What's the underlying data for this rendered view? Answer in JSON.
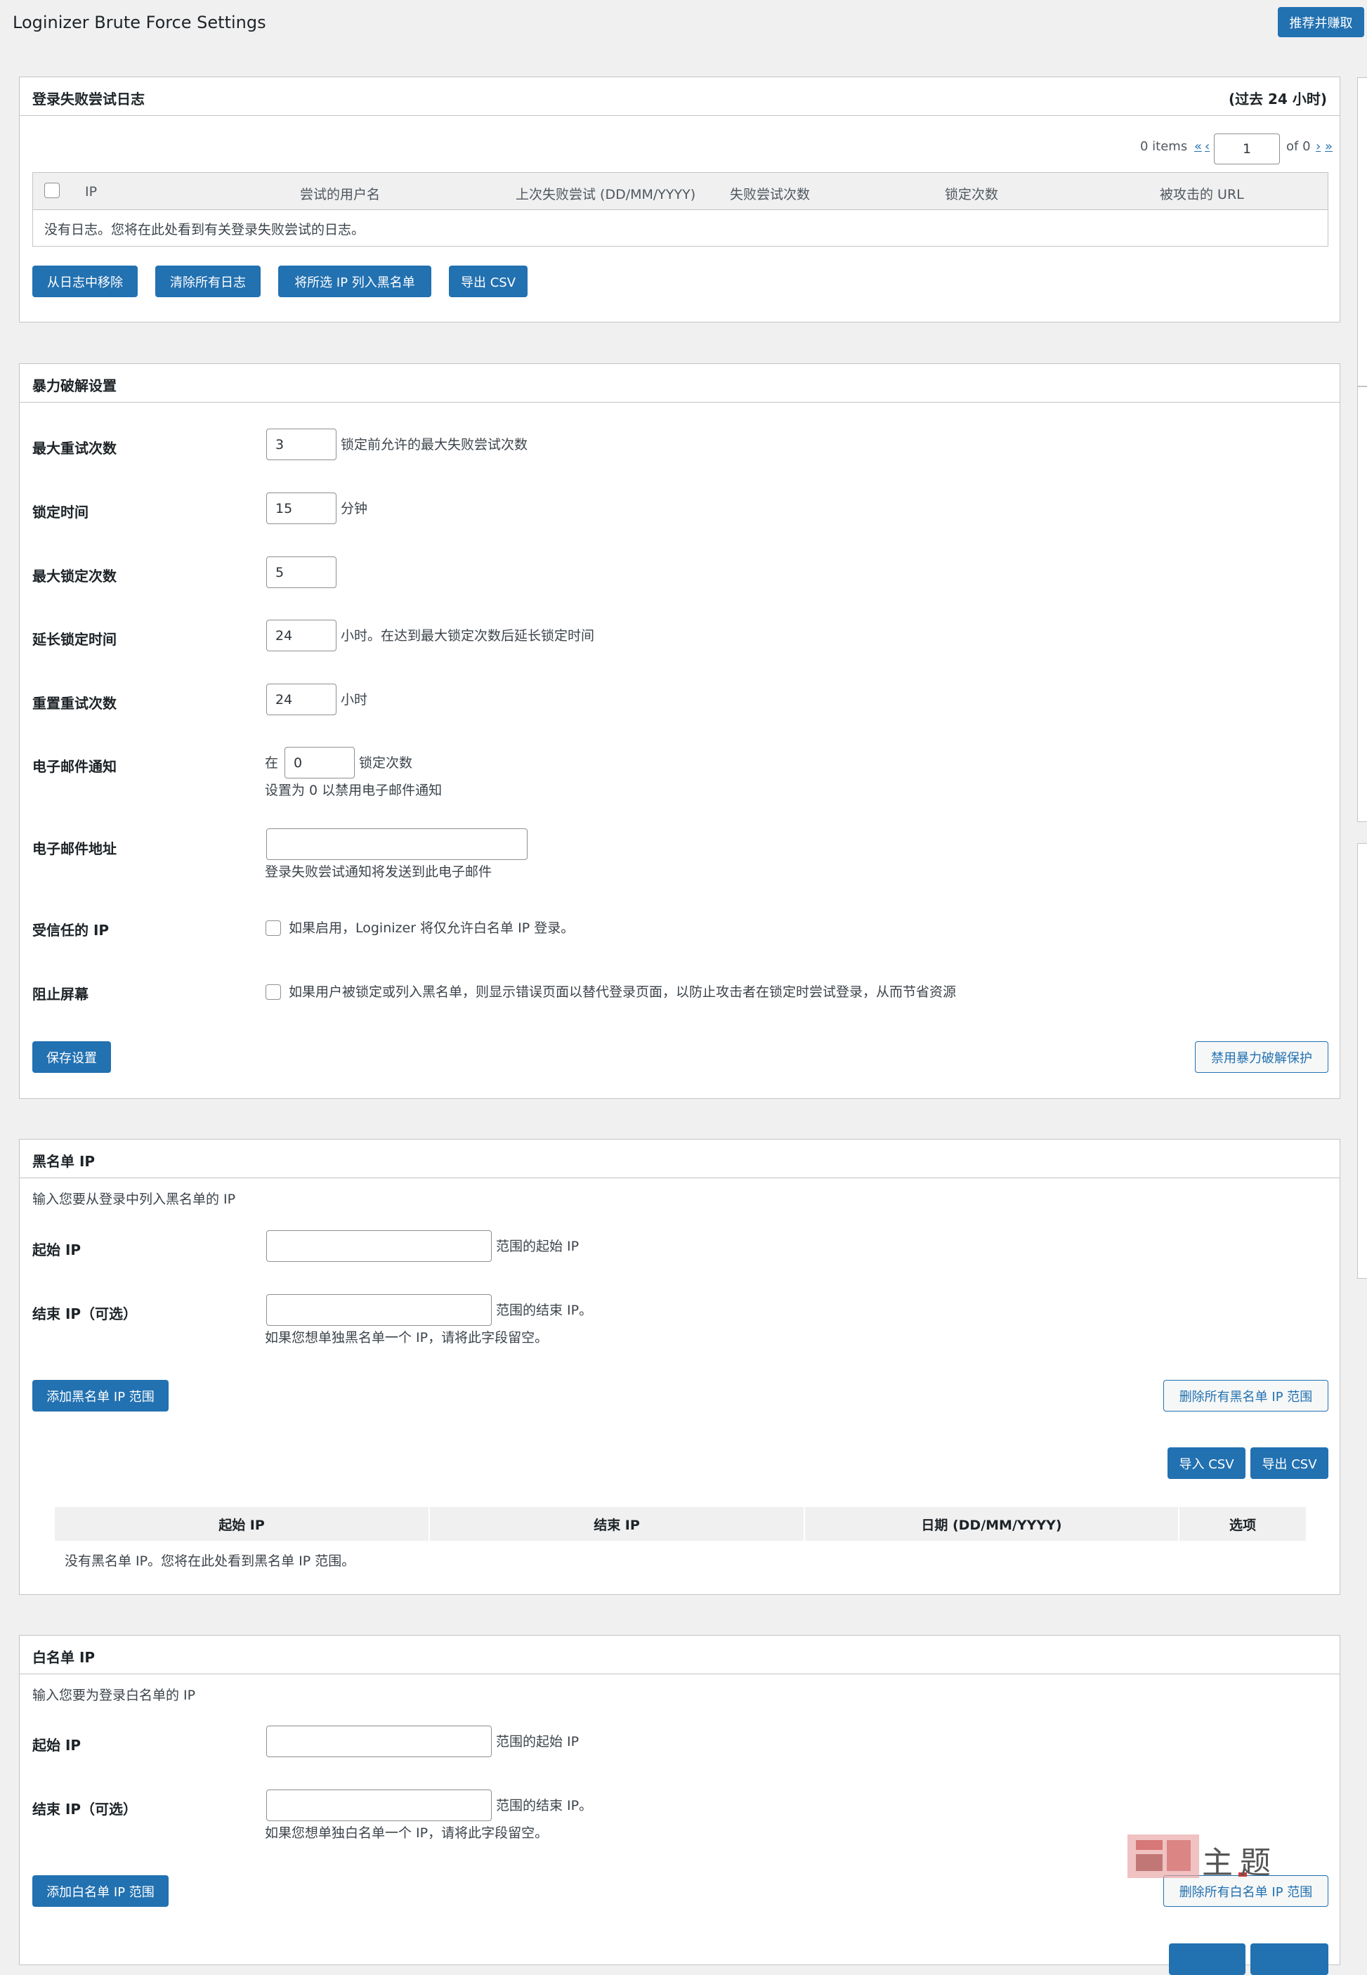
{
  "header": {
    "title": "Loginizer Brute Force Settings",
    "recommend_button": "推荐并赚取"
  },
  "logs": {
    "title": "登录失败尝试日志",
    "aside": "(过去 24 小时)",
    "pagination": {
      "items": "0 items",
      "first": "«",
      "prev": "‹",
      "page": "1",
      "of": "of 0",
      "next": "›",
      "last": "»"
    },
    "columns": [
      "IP",
      "尝试的用户名",
      "上次失败尝试 (DD/MM/YYYY)",
      "失败尝试次数",
      "锁定次数",
      "被攻击的 URL"
    ],
    "empty": "没有日志。您将在此处看到有关登录失败尝试的日志。",
    "buttons": [
      "从日志中移除",
      "清除所有日志",
      "将所选 IP 列入黑名单",
      "导出 CSV"
    ]
  },
  "bruteforce": {
    "title": "暴力破解设置",
    "max_retries": {
      "label": "最大重试次数",
      "value": "3",
      "desc": "锁定前允许的最大失败尝试次数"
    },
    "lockout_time": {
      "label": "锁定时间",
      "value": "15",
      "desc": "分钟"
    },
    "max_lockouts": {
      "label": "最大锁定次数",
      "value": "5"
    },
    "extend_lockout": {
      "label": "延长锁定时间",
      "value": "24",
      "desc": "小时。在达到最大锁定次数后延长锁定时间"
    },
    "reset_retries": {
      "label": "重置重试次数",
      "value": "24",
      "desc": "小时"
    },
    "email_notify": {
      "label": "电子邮件通知",
      "prefix": "在",
      "value": "0",
      "suffix": "锁定次数",
      "desc": "设置为 0 以禁用电子邮件通知"
    },
    "email_address": {
      "label": "电子邮件地址",
      "value": "",
      "desc": "登录失败尝试通知将发送到此电子邮件"
    },
    "trusted_ip": {
      "label": "受信任的 IP",
      "desc": "如果启用，Loginizer 将仅允许白名单 IP 登录。"
    },
    "blocking_screen": {
      "label": "阻止屏幕",
      "desc": "如果用户被锁定或列入黑名单，则显示错误页面以替代登录页面，以防止攻击者在锁定时尝试登录，从而节省资源"
    },
    "save_button": "保存设置",
    "disable_button": "禁用暴力破解保护"
  },
  "blacklist": {
    "title": "黑名单 IP",
    "intro": "输入您要从登录中列入黑名单的 IP",
    "start_label": "起始 IP",
    "start_desc": "范围的起始 IP",
    "end_label": "结束 IP（可选）",
    "end_desc": "范围的结束 IP。",
    "end_note": "如果您想单独黑名单一个 IP，请将此字段留空。",
    "add_button": "添加黑名单 IP 范围",
    "delete_button": "删除所有黑名单 IP 范围",
    "import_button": "导入 CSV",
    "export_button": "导出 CSV",
    "columns": [
      "起始 IP",
      "结束 IP",
      "日期 (DD/MM/YYYY)",
      "选项"
    ],
    "empty": "没有黑名单 IP。您将在此处看到黑名单 IP 范围。"
  },
  "whitelist": {
    "title": "白名单 IP",
    "intro": "输入您要为登录白名单的 IP",
    "start_label": "起始 IP",
    "start_desc": "范围的起始 IP",
    "end_label": "结束 IP（可选）",
    "end_desc": "范围的结束 IP。",
    "end_note": "如果您想单独白名单一个 IP，请将此字段留空。",
    "add_button": "添加白名单 IP 范围",
    "delete_button": "删除所有白名单 IP 范围"
  },
  "watermark": {
    "text": "主题"
  },
  "colors": {
    "primary": "#2271b1",
    "background": "#f0f0f1",
    "border": "#c3c4c7"
  }
}
